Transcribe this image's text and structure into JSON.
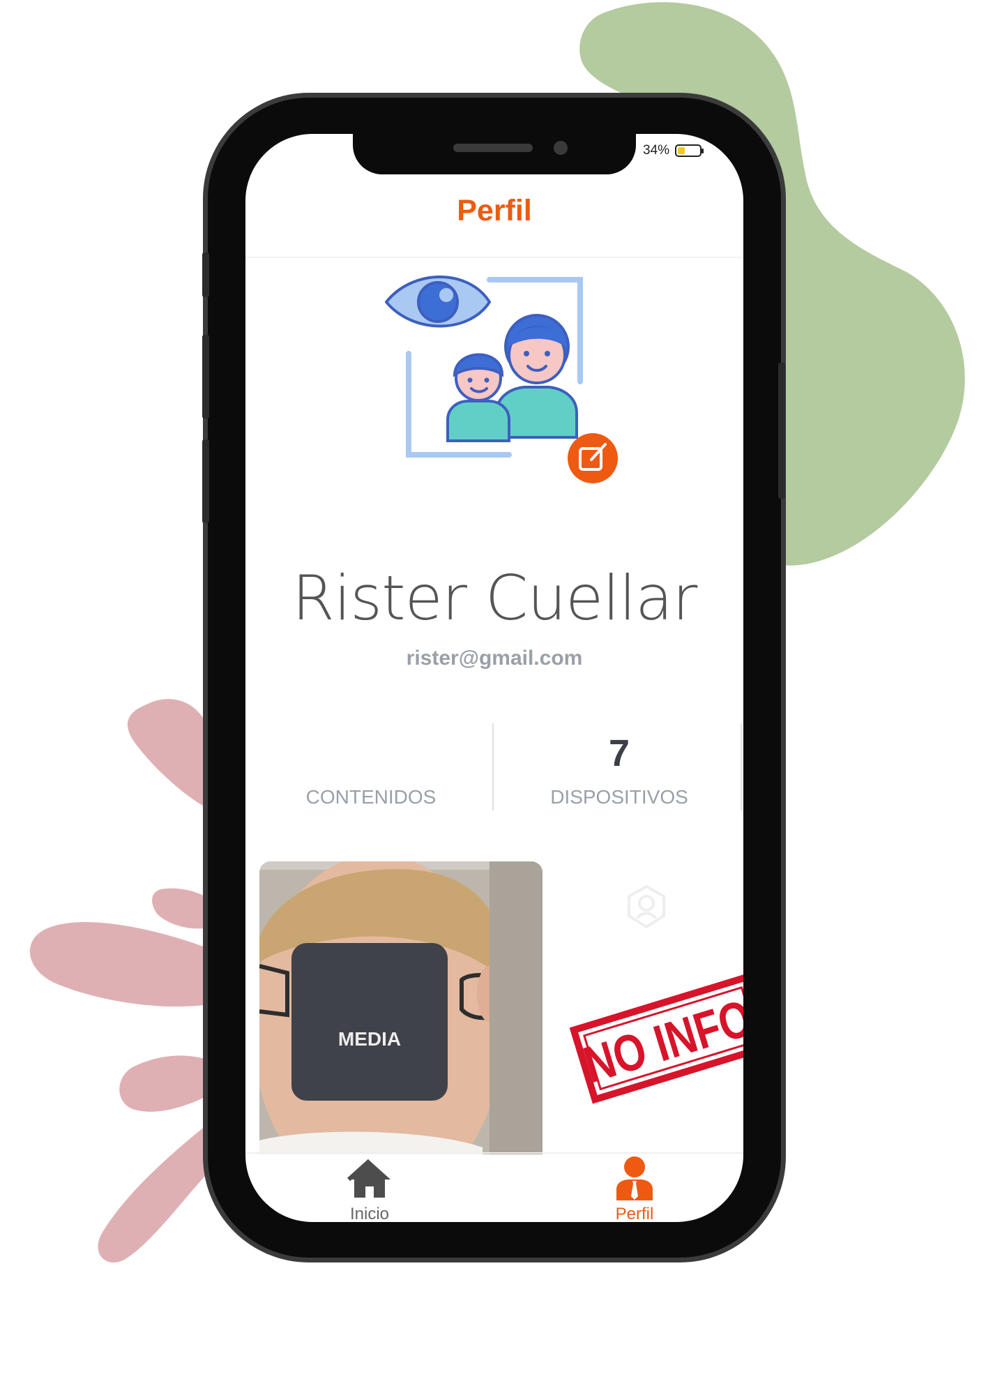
{
  "status_bar": {
    "battery_percent_label": "34%",
    "battery_level": 0.34
  },
  "header": {
    "title": "Perfil"
  },
  "profile": {
    "name": "Rister Cuellar",
    "email": "rister@gmail.com"
  },
  "stats": [
    {
      "value": "",
      "label": "CONTENIDOS"
    },
    {
      "value": "7",
      "label": "DISPOSITIVOS"
    }
  ],
  "content": {
    "media_card": {
      "overlay_label": "MEDIA"
    },
    "no_info_stamp": {
      "text": "NO INFO"
    }
  },
  "bottom_nav": [
    {
      "label": "Inicio",
      "icon": "home-icon",
      "active": false
    },
    {
      "label": "Perfil",
      "icon": "profile-user-icon",
      "active": true
    }
  ],
  "colors": {
    "accent": "#ee5a12",
    "stamp_red": "#d7142a",
    "green_blob": "#b3cb9e",
    "pink_blob": "#dfb0b3"
  }
}
